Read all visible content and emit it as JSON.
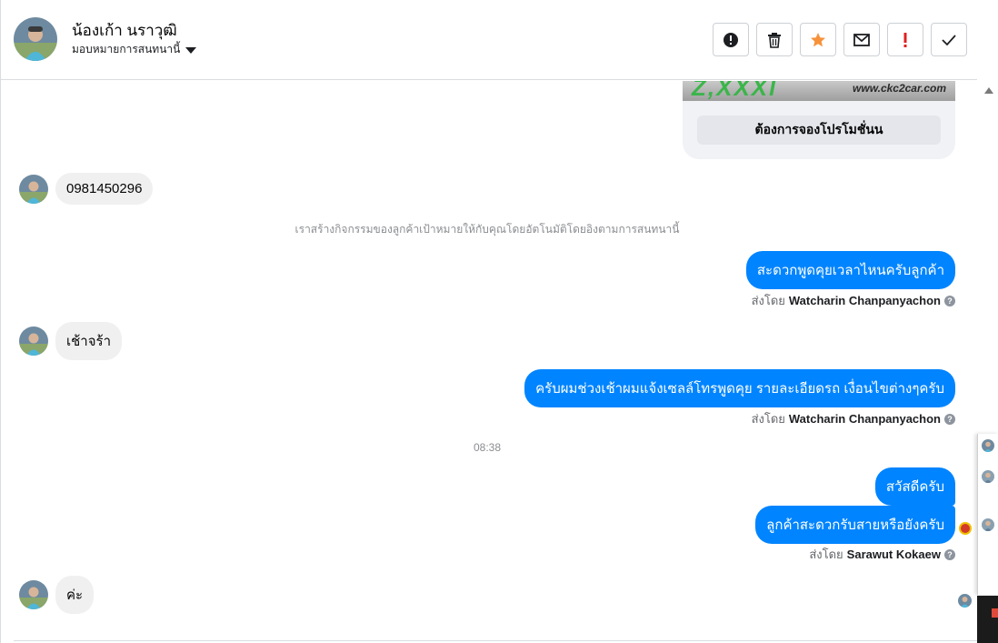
{
  "header": {
    "contact_name": "น้องเก้า นราวุฒิ",
    "assign_label": "มอบหมายการสนทนานี้"
  },
  "actions": [
    {
      "name": "report-spam-button",
      "icon": "exclamation-circle-icon",
      "color": "#1c1e21"
    },
    {
      "name": "delete-button",
      "icon": "trash-icon",
      "color": "#1c1e21"
    },
    {
      "name": "star-button",
      "icon": "star-icon",
      "color": "#f7923a"
    },
    {
      "name": "mark-unread-button",
      "icon": "envelope-icon",
      "color": "#1c1e21"
    },
    {
      "name": "follow-up-button",
      "icon": "exclamation-icon",
      "color": "#e02020"
    },
    {
      "name": "mark-done-button",
      "icon": "checkmark-icon",
      "color": "#1c1e21"
    }
  ],
  "card": {
    "brand_text": "Z,XXXl",
    "url_text": "www.ckc2car.com",
    "button_label": "ต้องการจองโปรโมชั่นน"
  },
  "messages": {
    "m1": "0981450296",
    "system_note": "เราสร้างกิจกรรมของลูกค้าเป้าหมายให้กับคุณโดยอัตโนมัติโดยอิงตามการสนทนานี้",
    "m2": "สะดวกพูดคุยเวลาไหนครับลูกค้า",
    "m3": "เช้าจร้า",
    "m4": "ครับผมช่วงเช้าผมแจ้งเซลล์โทรพูดคุย รายละเอียดรถ เงื่อนไขต่างๆครับ",
    "time": "08:38",
    "m5": "สวัสดีครับ",
    "m6": "ลูกค้าสะดวกรับสายหรือยังครับ",
    "m7": "ค่ะ"
  },
  "sent_by": {
    "prefix": "ส่งโดย",
    "agent1": "Watcharin Chanpanyachon",
    "agent2": "Sarawut Kokaew"
  },
  "colors": {
    "outgoing_bubble": "#0084ff",
    "incoming_bubble": "#f0f0f0"
  }
}
